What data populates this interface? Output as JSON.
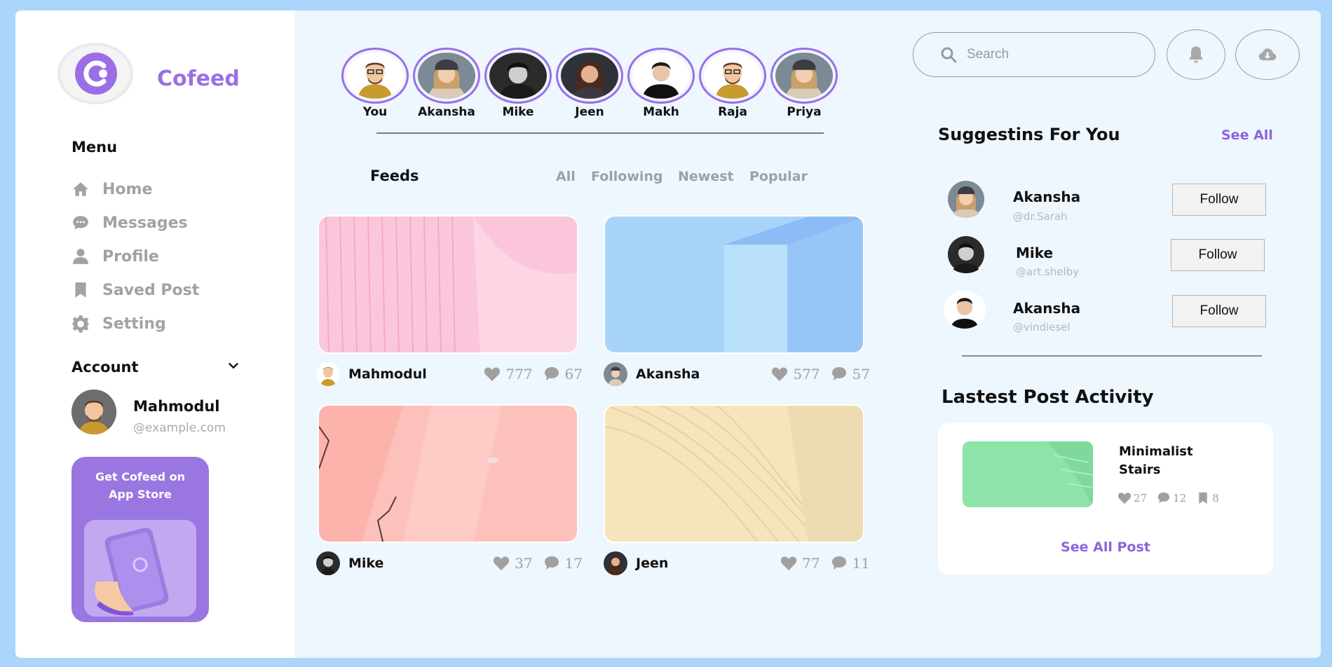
{
  "brand": {
    "name": "Cofeed",
    "accent": "#9b6ee6"
  },
  "menu": {
    "title": "Menu",
    "items": [
      {
        "label": "Home",
        "icon": "home-icon"
      },
      {
        "label": "Messages",
        "icon": "chat-icon"
      },
      {
        "label": "Profile",
        "icon": "user-icon"
      },
      {
        "label": "Saved Post",
        "icon": "bookmark-icon"
      },
      {
        "label": "Setting",
        "icon": "gear-icon"
      }
    ]
  },
  "account": {
    "title": "Account",
    "user": {
      "name": "Mahmodul",
      "email": "@example.com"
    }
  },
  "promo": {
    "text": "Get Cofeed on App Store"
  },
  "stories": [
    {
      "name": "You"
    },
    {
      "name": "Akansha"
    },
    {
      "name": "Mike"
    },
    {
      "name": "Jeen"
    },
    {
      "name": "Makh"
    },
    {
      "name": "Raja"
    },
    {
      "name": "Priya"
    }
  ],
  "feeds": {
    "title": "Feeds",
    "filters": [
      "All",
      "Following",
      "Newest",
      "Popular"
    ],
    "posts": [
      {
        "author": "Mahmodul",
        "likes": "777",
        "comments": "67",
        "color": "#fac3d8"
      },
      {
        "author": "Akansha",
        "likes": "577",
        "comments": "57",
        "color": "#a6d2f9"
      },
      {
        "author": "Mike",
        "likes": "37",
        "comments": "17",
        "color": "#fcc0ba"
      },
      {
        "author": "Jeen",
        "likes": "77",
        "comments": "11",
        "color": "#f5e5bd"
      }
    ]
  },
  "search": {
    "placeholder": "Search"
  },
  "suggestions": {
    "title": "Suggestins For You",
    "see_all": "See All",
    "follow_label": "Follow",
    "people": [
      {
        "name": "Akansha",
        "handle": "@dr.Sarah"
      },
      {
        "name": "Mike",
        "handle": "@art.shelby"
      },
      {
        "name": "Akansha",
        "handle": "@vindiesel"
      }
    ]
  },
  "activity": {
    "title": "Lastest Post Activity",
    "post_title": "Minimalist Stairs",
    "likes": "27",
    "comments": "12",
    "saves": "8",
    "see_all": "See All Post"
  }
}
